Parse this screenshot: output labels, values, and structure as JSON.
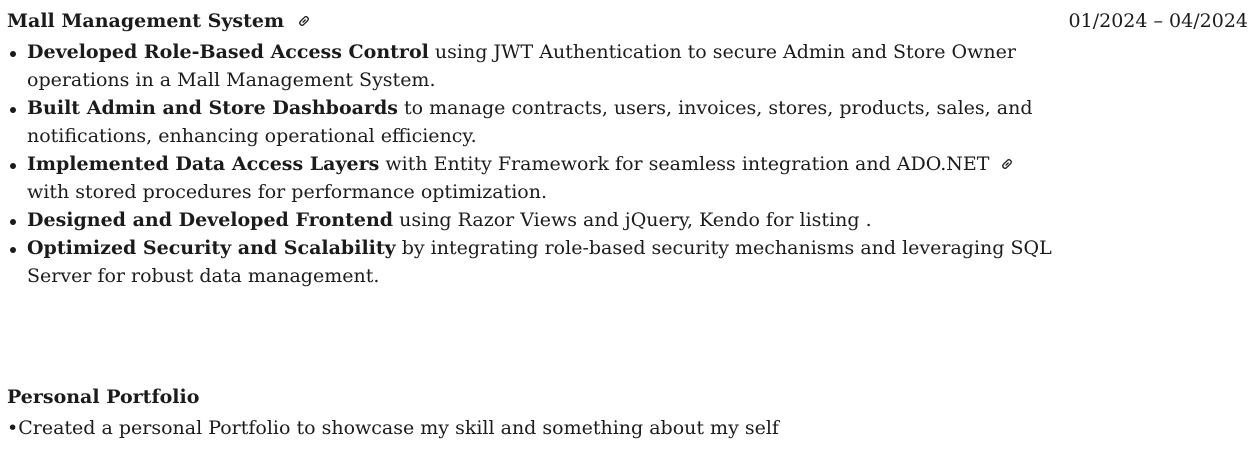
{
  "projects": [
    {
      "title": "Mall Management System",
      "date": "01/2024 – 04/2024",
      "bullets": [
        {
          "bold": "Developed Role-Based Access Control",
          "rest": "using JWT Authentication to secure Admin and Store Owner",
          "line2": "operations in a Mall Management System."
        },
        {
          "bold": "Built Admin and Store Dashboards",
          "rest": "to manage contracts, users, invoices, stores, products, sales, and",
          "line2": "notifications, enhancing operational efficiency."
        },
        {
          "bold": "Implemented Data Access Layers",
          "rest": "with Entity Framework for seamless integration and ADO.NET",
          "line2": "with stored procedures for performance optimization."
        },
        {
          "bold": "Designed and Developed Frontend",
          "rest": "using Razor Views and jQuery, Kendo for listing ."
        },
        {
          "bold": "Optimized Security and Scalability",
          "rest": "by integrating role-based security mechanisms and leveraging SQL",
          "line2": "Server for robust data management."
        }
      ],
      "title_link_icon": "link-icon"
    },
    {
      "title": "Personal Portfolio",
      "text": "•Created a personal Portfolio to showcase my skill and something about my self"
    }
  ]
}
